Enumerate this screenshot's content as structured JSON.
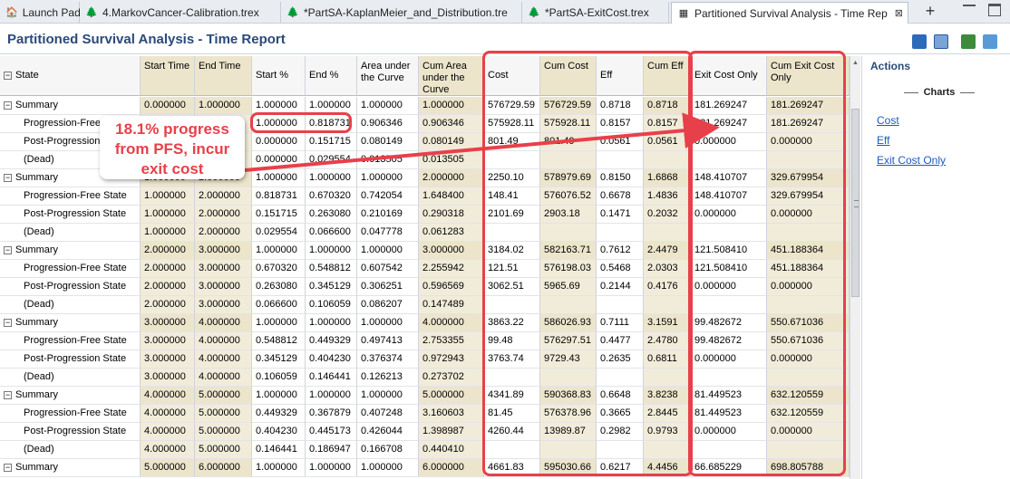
{
  "tabs": [
    {
      "label": "Launch Pad",
      "icon": "launchpad-icon"
    },
    {
      "label": "4.MarkovCancer-Calibration.trex",
      "icon": "tree-file-icon"
    },
    {
      "label": "*PartSA-KaplanMeier_and_Distribution.tre",
      "icon": "tree-file-icon"
    },
    {
      "label": "*PartSA-ExitCost.trex",
      "icon": "tree-file-icon"
    },
    {
      "label": "Partitioned Survival Analysis - Time Rep",
      "icon": "report-icon",
      "close": "⊠"
    }
  ],
  "report": {
    "title": "Partitioned Survival Analysis - Time Report"
  },
  "columns": {
    "state": "State",
    "start_time": "Start Time",
    "end_time": "End Time",
    "start_pct": "Start %",
    "end_pct": "End %",
    "auc": "Area under the Curve",
    "cum_auc": "Cum Area under the Curve",
    "cost": "Cost",
    "cum_cost": "Cum Cost",
    "eff": "Eff",
    "cum_eff": "Cum Eff",
    "exit_cost": "Exit Cost Only",
    "cum_exit_cost": "Cum Exit Cost Only"
  },
  "rows": [
    {
      "type": "summary",
      "state": "Summary",
      "start_time": "0.000000",
      "end_time": "1.000000",
      "start_pct": "1.000000",
      "end_pct": "1.000000",
      "auc": "1.000000",
      "cum_auc": "1.000000",
      "cost": "576729.59",
      "cum_cost": "576729.59",
      "eff": "0.8718",
      "cum_eff": "0.8718",
      "exit_cost": "181.269247",
      "cum_exit_cost": "181.269247"
    },
    {
      "type": "child",
      "state": "Progression-Free State",
      "start_time": "",
      "end_time": "",
      "start_pct": "1.000000",
      "end_pct": "0.818731",
      "auc": "0.906346",
      "cum_auc": "0.906346",
      "cost": "575928.11",
      "cum_cost": "575928.11",
      "eff": "0.8157",
      "cum_eff": "0.8157",
      "exit_cost": "181.269247",
      "cum_exit_cost": "181.269247"
    },
    {
      "type": "child",
      "state": "Post-Progression State",
      "start_time": "",
      "end_time": "",
      "start_pct": "0.000000",
      "end_pct": "0.151715",
      "auc": "0.080149",
      "cum_auc": "0.080149",
      "cost": "801.49",
      "cum_cost": "801.49",
      "eff": "0.0561",
      "cum_eff": "0.0561",
      "exit_cost": "0.000000",
      "cum_exit_cost": "0.000000"
    },
    {
      "type": "child",
      "state": "(Dead)",
      "start_time": "",
      "end_time": "",
      "start_pct": "0.000000",
      "end_pct": "0.029554",
      "auc": "0.013505",
      "cum_auc": "0.013505",
      "cost": "",
      "cum_cost": "",
      "eff": "",
      "cum_eff": "",
      "exit_cost": "",
      "cum_exit_cost": ""
    },
    {
      "type": "summary",
      "state": "Summary",
      "start_time": "1.000000",
      "end_time": "2.000000",
      "start_pct": "1.000000",
      "end_pct": "1.000000",
      "auc": "1.000000",
      "cum_auc": "2.000000",
      "cost": "2250.10",
      "cum_cost": "578979.69",
      "eff": "0.8150",
      "cum_eff": "1.6868",
      "exit_cost": "148.410707",
      "cum_exit_cost": "329.679954"
    },
    {
      "type": "child",
      "state": "Progression-Free State",
      "start_time": "1.000000",
      "end_time": "2.000000",
      "start_pct": "0.818731",
      "end_pct": "0.670320",
      "auc": "0.742054",
      "cum_auc": "1.648400",
      "cost": "148.41",
      "cum_cost": "576076.52",
      "eff": "0.6678",
      "cum_eff": "1.4836",
      "exit_cost": "148.410707",
      "cum_exit_cost": "329.679954"
    },
    {
      "type": "child",
      "state": "Post-Progression State",
      "start_time": "1.000000",
      "end_time": "2.000000",
      "start_pct": "0.151715",
      "end_pct": "0.263080",
      "auc": "0.210169",
      "cum_auc": "0.290318",
      "cost": "2101.69",
      "cum_cost": "2903.18",
      "eff": "0.1471",
      "cum_eff": "0.2032",
      "exit_cost": "0.000000",
      "cum_exit_cost": "0.000000"
    },
    {
      "type": "child",
      "state": "(Dead)",
      "start_time": "1.000000",
      "end_time": "2.000000",
      "start_pct": "0.029554",
      "end_pct": "0.066600",
      "auc": "0.047778",
      "cum_auc": "0.061283",
      "cost": "",
      "cum_cost": "",
      "eff": "",
      "cum_eff": "",
      "exit_cost": "",
      "cum_exit_cost": ""
    },
    {
      "type": "summary",
      "state": "Summary",
      "start_time": "2.000000",
      "end_time": "3.000000",
      "start_pct": "1.000000",
      "end_pct": "1.000000",
      "auc": "1.000000",
      "cum_auc": "3.000000",
      "cost": "3184.02",
      "cum_cost": "582163.71",
      "eff": "0.7612",
      "cum_eff": "2.4479",
      "exit_cost": "121.508410",
      "cum_exit_cost": "451.188364"
    },
    {
      "type": "child",
      "state": "Progression-Free State",
      "start_time": "2.000000",
      "end_time": "3.000000",
      "start_pct": "0.670320",
      "end_pct": "0.548812",
      "auc": "0.607542",
      "cum_auc": "2.255942",
      "cost": "121.51",
      "cum_cost": "576198.03",
      "eff": "0.5468",
      "cum_eff": "2.0303",
      "exit_cost": "121.508410",
      "cum_exit_cost": "451.188364"
    },
    {
      "type": "child",
      "state": "Post-Progression State",
      "start_time": "2.000000",
      "end_time": "3.000000",
      "start_pct": "0.263080",
      "end_pct": "0.345129",
      "auc": "0.306251",
      "cum_auc": "0.596569",
      "cost": "3062.51",
      "cum_cost": "5965.69",
      "eff": "0.2144",
      "cum_eff": "0.4176",
      "exit_cost": "0.000000",
      "cum_exit_cost": "0.000000"
    },
    {
      "type": "child",
      "state": "(Dead)",
      "start_time": "2.000000",
      "end_time": "3.000000",
      "start_pct": "0.066600",
      "end_pct": "0.106059",
      "auc": "0.086207",
      "cum_auc": "0.147489",
      "cost": "",
      "cum_cost": "",
      "eff": "",
      "cum_eff": "",
      "exit_cost": "",
      "cum_exit_cost": ""
    },
    {
      "type": "summary",
      "state": "Summary",
      "start_time": "3.000000",
      "end_time": "4.000000",
      "start_pct": "1.000000",
      "end_pct": "1.000000",
      "auc": "1.000000",
      "cum_auc": "4.000000",
      "cost": "3863.22",
      "cum_cost": "586026.93",
      "eff": "0.7111",
      "cum_eff": "3.1591",
      "exit_cost": "99.482672",
      "cum_exit_cost": "550.671036"
    },
    {
      "type": "child",
      "state": "Progression-Free State",
      "start_time": "3.000000",
      "end_time": "4.000000",
      "start_pct": "0.548812",
      "end_pct": "0.449329",
      "auc": "0.497413",
      "cum_auc": "2.753355",
      "cost": "99.48",
      "cum_cost": "576297.51",
      "eff": "0.4477",
      "cum_eff": "2.4780",
      "exit_cost": "99.482672",
      "cum_exit_cost": "550.671036"
    },
    {
      "type": "child",
      "state": "Post-Progression State",
      "start_time": "3.000000",
      "end_time": "4.000000",
      "start_pct": "0.345129",
      "end_pct": "0.404230",
      "auc": "0.376374",
      "cum_auc": "0.972943",
      "cost": "3763.74",
      "cum_cost": "9729.43",
      "eff": "0.2635",
      "cum_eff": "0.6811",
      "exit_cost": "0.000000",
      "cum_exit_cost": "0.000000"
    },
    {
      "type": "child",
      "state": "(Dead)",
      "start_time": "3.000000",
      "end_time": "4.000000",
      "start_pct": "0.106059",
      "end_pct": "0.146441",
      "auc": "0.126213",
      "cum_auc": "0.273702",
      "cost": "",
      "cum_cost": "",
      "eff": "",
      "cum_eff": "",
      "exit_cost": "",
      "cum_exit_cost": ""
    },
    {
      "type": "summary",
      "state": "Summary",
      "start_time": "4.000000",
      "end_time": "5.000000",
      "start_pct": "1.000000",
      "end_pct": "1.000000",
      "auc": "1.000000",
      "cum_auc": "5.000000",
      "cost": "4341.89",
      "cum_cost": "590368.83",
      "eff": "0.6648",
      "cum_eff": "3.8238",
      "exit_cost": "81.449523",
      "cum_exit_cost": "632.120559"
    },
    {
      "type": "child",
      "state": "Progression-Free State",
      "start_time": "4.000000",
      "end_time": "5.000000",
      "start_pct": "0.449329",
      "end_pct": "0.367879",
      "auc": "0.407248",
      "cum_auc": "3.160603",
      "cost": "81.45",
      "cum_cost": "576378.96",
      "eff": "0.3665",
      "cum_eff": "2.8445",
      "exit_cost": "81.449523",
      "cum_exit_cost": "632.120559"
    },
    {
      "type": "child",
      "state": "Post-Progression State",
      "start_time": "4.000000",
      "end_time": "5.000000",
      "start_pct": "0.404230",
      "end_pct": "0.445173",
      "auc": "0.426044",
      "cum_auc": "1.398987",
      "cost": "4260.44",
      "cum_cost": "13989.87",
      "eff": "0.2982",
      "cum_eff": "0.9793",
      "exit_cost": "0.000000",
      "cum_exit_cost": "0.000000"
    },
    {
      "type": "child",
      "state": "(Dead)",
      "start_time": "4.000000",
      "end_time": "5.000000",
      "start_pct": "0.146441",
      "end_pct": "0.186947",
      "auc": "0.166708",
      "cum_auc": "0.440410",
      "cost": "",
      "cum_cost": "",
      "eff": "",
      "cum_eff": "",
      "exit_cost": "",
      "cum_exit_cost": ""
    },
    {
      "type": "summary",
      "state": "Summary",
      "start_time": "5.000000",
      "end_time": "6.000000",
      "start_pct": "1.000000",
      "end_pct": "1.000000",
      "auc": "1.000000",
      "cum_auc": "6.000000",
      "cost": "4661.83",
      "cum_cost": "595030.66",
      "eff": "0.6217",
      "cum_eff": "4.4456",
      "exit_cost": "66.685229",
      "cum_exit_cost": "698.805788"
    }
  ],
  "actions": {
    "title": "Actions",
    "charts_heading": "Charts",
    "links": [
      "Cost",
      "Eff",
      "Exit Cost Only"
    ]
  },
  "annotation": {
    "text": "18.1% progress from PFS, incur exit cost",
    "color": "#e8404a"
  },
  "colors": {
    "title": "#2a4a7a",
    "link": "#1a5bbf",
    "tan_column": "#f1ecd9",
    "annotation_red": "#e8404a"
  }
}
